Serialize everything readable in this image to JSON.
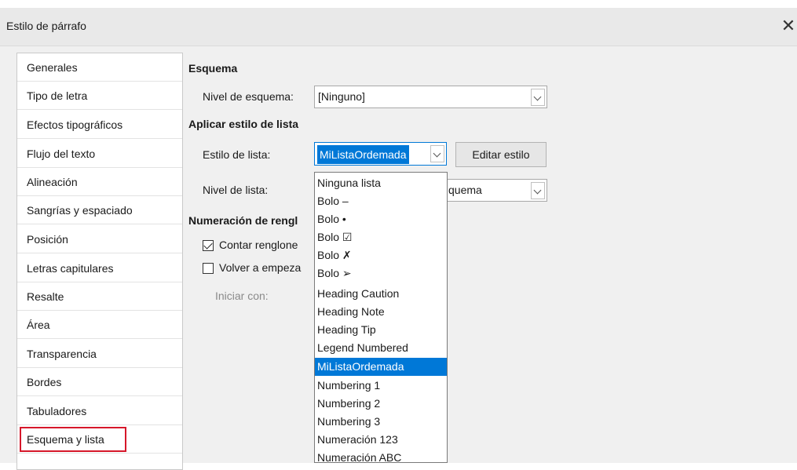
{
  "window": {
    "title": "Estilo de párrafo",
    "close_glyph": "✕"
  },
  "sidebar": {
    "items": [
      {
        "label": "Generales"
      },
      {
        "label": "Tipo de letra"
      },
      {
        "label": "Efectos tipográficos"
      },
      {
        "label": "Flujo del texto"
      },
      {
        "label": "Alineación"
      },
      {
        "label": "Sangrías y espaciado"
      },
      {
        "label": "Posición"
      },
      {
        "label": "Letras capitulares"
      },
      {
        "label": "Resalte"
      },
      {
        "label": "Área"
      },
      {
        "label": "Transparencia"
      },
      {
        "label": "Bordes"
      },
      {
        "label": "Tabuladores"
      },
      {
        "label": "Esquema y lista"
      }
    ],
    "selected": "Esquema y lista"
  },
  "outline": {
    "header": "Esquema",
    "level_label": "Nivel de esquema:",
    "level_value": "[Ninguno]"
  },
  "list_style": {
    "header": "Aplicar estilo de lista",
    "style_label": "Estilo de lista:",
    "style_value": "MiListaOrdemada",
    "edit_button": "Editar estilo",
    "level_label": "Nivel de lista:",
    "level_value_partial": "quema"
  },
  "numbering": {
    "header_partial": "Numeración de rengl",
    "count_lines_partial": "Contar renglone",
    "count_lines_checked": true,
    "restart_partial": "Volver a empeza",
    "restart_checked": false,
    "start_with_label": "Iniciar con:"
  },
  "dropdown": {
    "options": [
      "Ninguna lista",
      "Bolo –",
      "Bolo •",
      "Bolo ☑",
      "Bolo ✗",
      "Bolo ➢",
      "Heading Caution",
      "Heading Note",
      "Heading Tip",
      "Legend Numbered",
      "MiListaOrdemada",
      "Numbering 1",
      "Numbering 2",
      "Numbering 3",
      "Numeración 123",
      "Numeración ABC"
    ],
    "active": "MiListaOrdemada"
  },
  "colors": {
    "accent": "#0078d7",
    "selection_border": "#d6172a"
  }
}
